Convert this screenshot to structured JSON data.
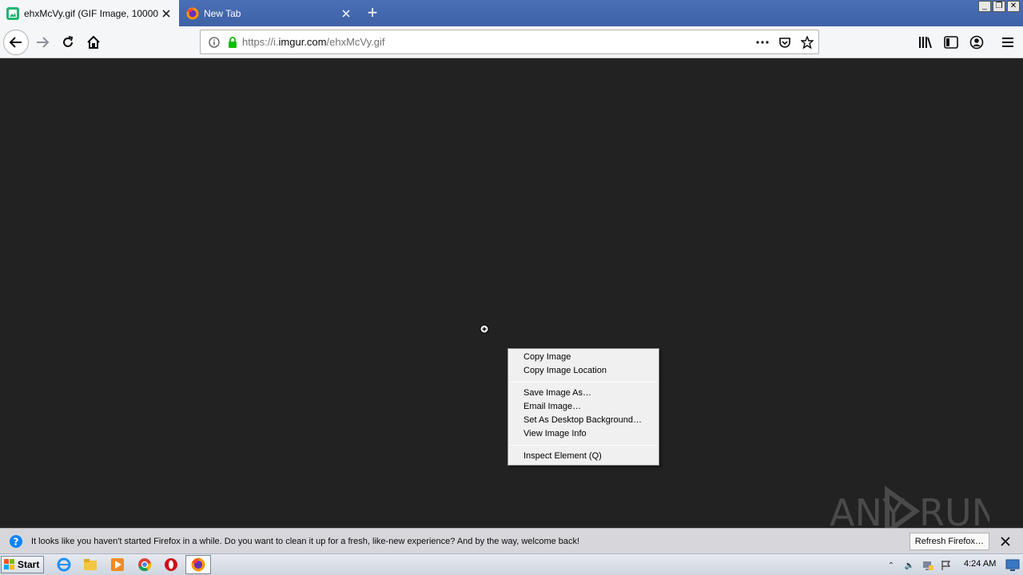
{
  "tabs": [
    {
      "title": "ehxMcVy.gif (GIF Image, 10000 ×",
      "active": true,
      "favicon": "imgur-icon"
    },
    {
      "title": "New Tab",
      "active": false,
      "favicon": "firefox-icon"
    }
  ],
  "urlbar": {
    "prefix": "https://i.",
    "domain": "imgur.com",
    "path": "/ehxMcVy.gif"
  },
  "context_menu": {
    "groups": [
      [
        "Copy Image",
        "Copy Image Location"
      ],
      [
        "Save Image As…",
        "Email Image…",
        "Set As Desktop Background…",
        "View Image Info"
      ],
      [
        "Inspect Element (Q)"
      ]
    ]
  },
  "notification": {
    "message": "It looks like you haven't started Firefox in a while. Do you want to clean it up for a fresh, like-new experience? And by the way, welcome back!",
    "button": "Refresh Firefox…"
  },
  "taskbar": {
    "start_label": "Start",
    "clock": "4:24 AM"
  },
  "watermark": "ANY RUN",
  "colors": {
    "tabstrip": "#3f62a6",
    "content_bg": "#222222",
    "lock_green": "#12bc00"
  }
}
